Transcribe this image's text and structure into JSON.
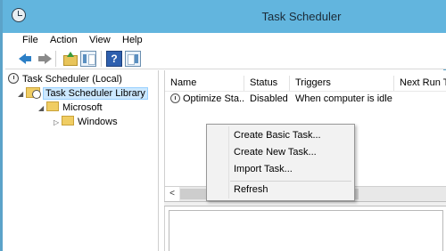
{
  "window": {
    "title": "Task Scheduler"
  },
  "menubar": {
    "items": [
      "File",
      "Action",
      "View",
      "Help"
    ]
  },
  "toolbar": {
    "help_glyph": "?"
  },
  "tree": {
    "items": [
      {
        "label": "Task Scheduler (Local)"
      },
      {
        "label": "Task Scheduler Library",
        "selected": true,
        "expander": "◢"
      },
      {
        "label": "Microsoft",
        "expander": "◢"
      },
      {
        "label": "Windows",
        "expander": "▷"
      }
    ]
  },
  "list": {
    "columns": [
      "Name",
      "Status",
      "Triggers",
      "Next Run Tim"
    ],
    "rows": [
      {
        "name": "Optimize Sta...",
        "status": "Disabled",
        "triggers": "When computer is idle",
        "next_run": ""
      }
    ]
  },
  "scrollbar": {
    "left_arrow": "<"
  },
  "context_menu": {
    "items": [
      "Create Basic Task...",
      "Create New Task...",
      "Import Task...",
      "Refresh"
    ]
  },
  "colors": {
    "titlebar": "#62b5de",
    "selection": "#cce8ff",
    "accent": "#2c7fc6"
  }
}
